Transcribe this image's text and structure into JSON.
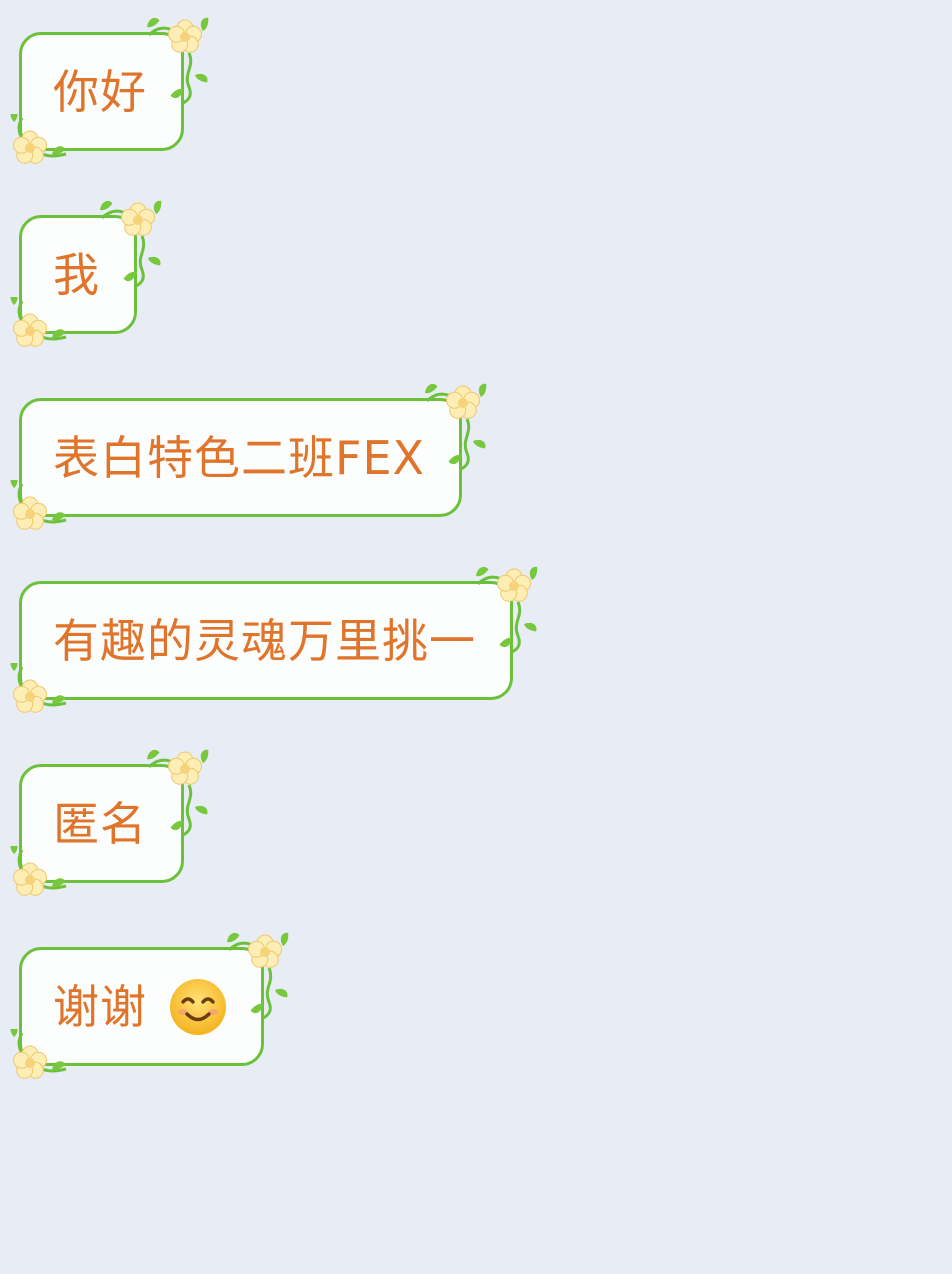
{
  "messages": [
    {
      "text": "你好"
    },
    {
      "text": "我"
    },
    {
      "text": "表白特色二班FEX"
    },
    {
      "text": "有趣的灵魂万里挑一"
    },
    {
      "text": "匿名"
    },
    {
      "text": "谢谢",
      "emoji": "smiling-face-icon"
    }
  ],
  "colors": {
    "background": "#e8edf5",
    "bubble_fill": "#fcfdfd",
    "bubble_border": "#6bc23a",
    "text": "#e0742a",
    "flower": "#fbe6a4",
    "leaf": "#78c83e"
  }
}
